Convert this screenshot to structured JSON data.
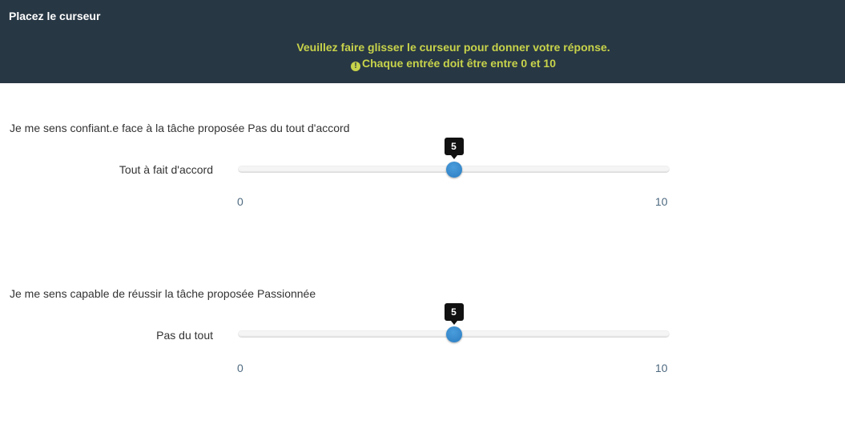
{
  "header": {
    "title": "Placez le curseur",
    "instruction": "Veuillez faire glisser le curseur pour donner votre réponse.",
    "warning": "Chaque entrée doit être entre 0 et 10",
    "warning_icon": "exclamation-circle-icon",
    "bg_color": "#283744",
    "accent_color": "#c7d34a"
  },
  "questions": [
    {
      "text": "Je me sens confiant.e face à la tâche proposée Pas du tout d'accord",
      "slider_label": "Tout à fait d'accord",
      "min_label": "0",
      "max_label": "10",
      "min": 0,
      "max": 10,
      "value": 5,
      "value_label": "5"
    },
    {
      "text": "Je me sens capable de réussir la tâche proposée Passionnée",
      "slider_label": "Pas du tout",
      "min_label": "0",
      "max_label": "10",
      "min": 0,
      "max": 10,
      "value": 5,
      "value_label": "5"
    }
  ]
}
